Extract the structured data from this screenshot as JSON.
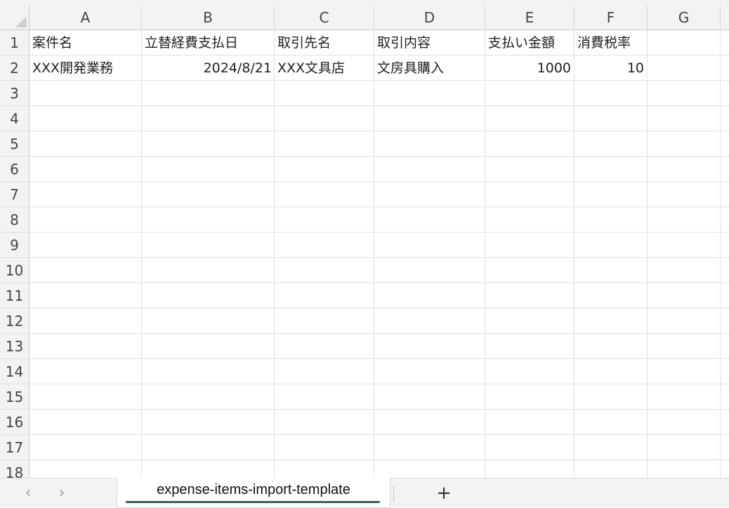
{
  "columns": [
    "A",
    "B",
    "C",
    "D",
    "E",
    "F",
    "G"
  ],
  "rows": [
    "1",
    "2",
    "3",
    "4",
    "5",
    "6",
    "7",
    "8",
    "9",
    "10",
    "11",
    "12",
    "13",
    "14",
    "15",
    "16",
    "17",
    "18"
  ],
  "cells": {
    "r1": [
      "案件名",
      "立替経費支払日",
      "取引先名",
      "取引内容",
      "支払い金額",
      "消費税率",
      ""
    ],
    "r2": [
      "XXX開発業務",
      "2024/8/21",
      "XXX文具店",
      "文房具購入",
      "1000",
      "10",
      ""
    ]
  },
  "sheet_tabs": {
    "active": "expense-items-import-template",
    "prev_icon": "‹",
    "next_icon": "›",
    "add_icon": "+"
  }
}
